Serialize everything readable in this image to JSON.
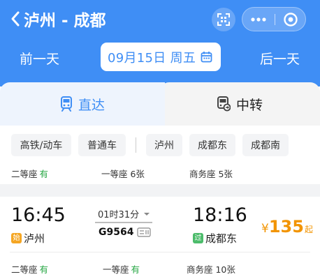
{
  "header": {
    "title": "泸州 - 成都",
    "prev_day": "前一天",
    "next_day": "后一天",
    "date": "09月15日 周五",
    "bg_color": "#3f8ef5"
  },
  "tabs": {
    "direct": "直达",
    "transfer": "中转"
  },
  "filters": {
    "train_types": [
      "高铁/动车",
      "普通车"
    ],
    "stations": [
      "泸州",
      "成都东",
      "成都南"
    ]
  },
  "summary_seats": {
    "second_class": "二等座",
    "second_class_status": "有",
    "first_class": "一等座 6张",
    "business_class": "商务座 5张"
  },
  "train": {
    "depart_time": "16:45",
    "depart_tag": "始",
    "depart_station": "泸州",
    "duration": "01时31分",
    "train_number": "G9564",
    "arrive_time": "18:16",
    "arrive_tag": "过",
    "arrive_station": "成都东",
    "price_currency": "¥",
    "price_amount": "135",
    "price_suffix": "起",
    "seats": {
      "second_class": "二等座",
      "second_class_status": "有",
      "first_class": "一等座",
      "first_class_status": "有",
      "business_class": "商务座 10张"
    }
  },
  "icons": {
    "back": "back-chevron-icon",
    "qr": "qr-scan-icon",
    "more": "more-dots-icon",
    "close": "close-circle-icon",
    "calendar": "calendar-icon",
    "train_direct": "train-icon",
    "train_transfer": "transfer-train-icon",
    "caret": "caret-down-icon",
    "ticket": "e-ticket-icon"
  }
}
